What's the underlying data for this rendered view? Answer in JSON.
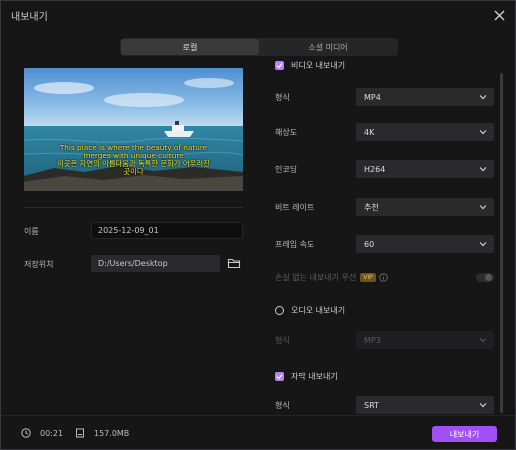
{
  "window": {
    "title": "내보내기"
  },
  "tabs": [
    {
      "label": "로컬",
      "active": true
    },
    {
      "label": "소셜 미디어",
      "active": false
    }
  ],
  "preview": {
    "caption_lines": [
      "This place is where the beauty of nature",
      "merges with unique culture",
      "이곳은 자연의 아름다움과 독특한 문화가 어우러진",
      "곳이다"
    ]
  },
  "file": {
    "name_label": "이름",
    "name_value": "2025-12-09_01",
    "location_label": "저장위치",
    "location_value": "D:/Users/Desktop"
  },
  "video_settings": {
    "section_label": "비디오 내보내기",
    "rows": [
      {
        "label": "형식",
        "value": "MP4"
      },
      {
        "label": "해상도",
        "value": "4K"
      },
      {
        "label": "인코딩",
        "value": "H264"
      },
      {
        "label": "비트 레이트",
        "value": "추천"
      },
      {
        "label": "프레임 속도",
        "value": "60"
      }
    ],
    "lossless_label": "손실 없는 내보내기 우선",
    "vip_badge": "VIP"
  },
  "audio_settings": {
    "section_label": "오디오 내보내기",
    "format_label": "형식",
    "format_value": "MP3"
  },
  "subtitle_settings": {
    "section_label": "자막 내보내기",
    "format_label": "형식",
    "format_value": "SRT"
  },
  "footer": {
    "duration": "00:21",
    "size": "157.0MB",
    "export_label": "내보내기"
  },
  "colors": {
    "accent": "#a14ff5",
    "checkbox": "#b583f2",
    "caption": "#f5e530"
  }
}
